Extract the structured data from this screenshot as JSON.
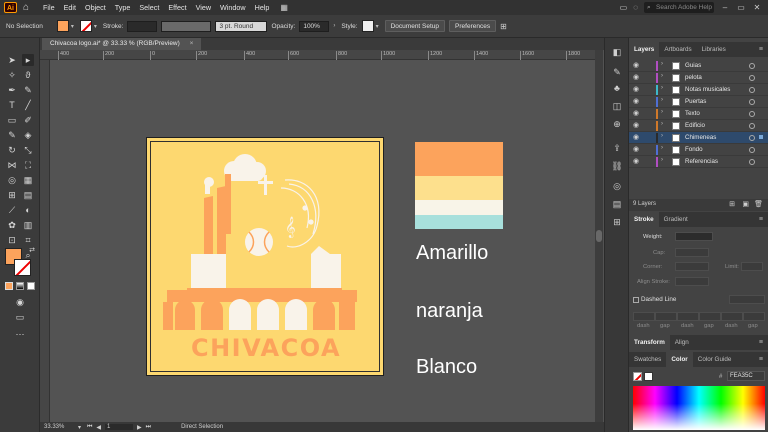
{
  "app": {
    "logo": "Ai",
    "search_placeholder": "Search Adobe Help"
  },
  "menu": [
    "File",
    "Edit",
    "Object",
    "Type",
    "Select",
    "Effect",
    "View",
    "Window",
    "Help"
  ],
  "control_bar": {
    "selection": "No Selection",
    "stroke_label": "Stroke:",
    "stroke_profile": "3 pt. Round",
    "opacity_label": "Opacity:",
    "opacity_value": "100%",
    "style_label": "Style:",
    "doc_setup": "Document Setup",
    "preferences": "Preferences",
    "fill_color": "#fca35c"
  },
  "document_tab": {
    "title": "Chivacoa logo.ai* @ 33.33 % (RGB/Preview)",
    "close": "×"
  },
  "ruler": [
    "400",
    "200",
    "0",
    "200",
    "400",
    "600",
    "800",
    "1000",
    "1200",
    "1400",
    "1600",
    "1800"
  ],
  "artboard": {
    "logo_text": "CHIVACOA",
    "colors": {
      "background": "#fdd870",
      "orange": "#fca35c",
      "white": "#f9f3ea",
      "text": "#fca35c"
    }
  },
  "palette": {
    "stripes": [
      "#fca35c",
      "#fde08d",
      "#f8f4e8",
      "#a8e0dc"
    ],
    "labels": [
      "Amarillo",
      "naranja",
      "Blanco"
    ]
  },
  "status": {
    "zoom": "33.33%",
    "page": "1",
    "tool": "Direct Selection"
  },
  "layers_panel": {
    "tabs": [
      "Layers",
      "Artboards",
      "Libraries"
    ],
    "layers": [
      {
        "name": "Guias",
        "color": "#b14ec2"
      },
      {
        "name": "pelota",
        "color": "#b14ec2"
      },
      {
        "name": "Notas musicales",
        "color": "#3db9c9"
      },
      {
        "name": "Puertas",
        "color": "#4f6fd4"
      },
      {
        "name": "Texto",
        "color": "#d0792a"
      },
      {
        "name": "Edificio",
        "color": "#d0792a"
      },
      {
        "name": "Chimeneas",
        "color": "#2b2b2b"
      },
      {
        "name": "Fondo",
        "color": "#4f6fd4"
      },
      {
        "name": "Referencias",
        "color": "#b14ec2"
      }
    ],
    "count": "9 Layers"
  },
  "stroke_panel": {
    "tabs": [
      "Stroke",
      "Gradient"
    ],
    "weight_label": "Weight:",
    "cap_label": "Cap:",
    "corner_label": "Corner:",
    "limit_label": "Limit:",
    "align_label": "Align Stroke:",
    "dashed_label": "Dashed Line",
    "dash_labels": [
      "dash",
      "gap",
      "dash",
      "gap",
      "dash",
      "gap"
    ]
  },
  "transform_tabs": [
    "Transform",
    "Align"
  ],
  "color_panel": {
    "tabs": [
      "Swatches",
      "Color",
      "Color Guide"
    ],
    "hex": "FEA35C"
  }
}
